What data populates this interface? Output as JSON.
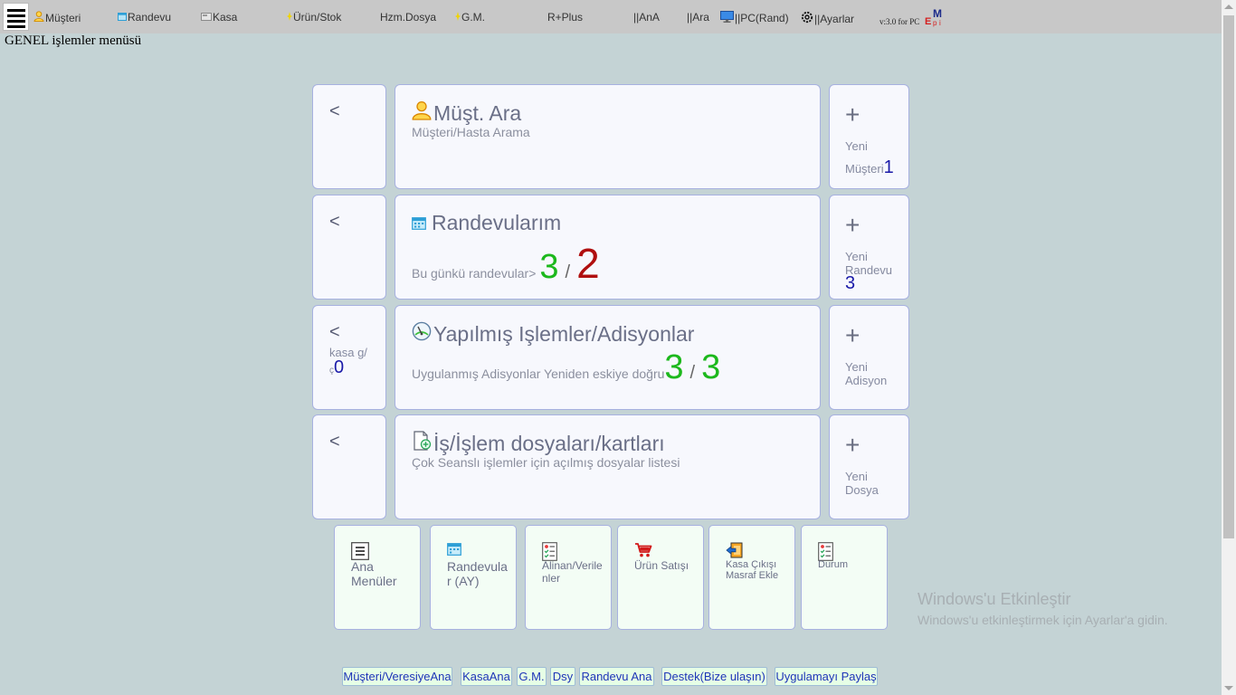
{
  "topbar": {
    "menu_icon": "hamburger-menu-icon",
    "items": [
      {
        "label": "Müşteri",
        "icon": "user-icon"
      },
      {
        "label": "Randevu",
        "icon": "calendar-icon"
      },
      {
        "label": "Kasa",
        "icon": "cash-register-icon"
      },
      {
        "label": "Ürün/Stok",
        "icon": "sparkle-icon"
      },
      {
        "label": "Hzm.Dosya"
      },
      {
        "label": "G.M.",
        "icon": "sparkle-icon"
      },
      {
        "label": "R+Plus"
      },
      {
        "label": "||AnA"
      },
      {
        "label": "||Ara"
      },
      {
        "label": "||PC(Rand)",
        "icon": "monitor-icon"
      },
      {
        "label": "||Ayarlar",
        "icon": "gear-icon"
      }
    ],
    "version": "v:3.0 for PC",
    "logo": {
      "m": "M",
      "e": "E",
      "p": "p",
      "i": "i"
    }
  },
  "page_heading": "GENEL işlemler menüsü",
  "rows": [
    {
      "back": {
        "label": "<"
      },
      "main": {
        "title": "Müşt. Ara",
        "icon": "user-icon",
        "subtitle": "Müşteri/Hasta Arama"
      },
      "add": {
        "plus": "+",
        "label_line1": "Yeni",
        "label_line2": "Müşteri",
        "count": "1"
      }
    },
    {
      "back": {
        "label": "<"
      },
      "main": {
        "title": "Randevularım",
        "icon": "calendar-icon",
        "count_label": "Bu günkü randevular>",
        "count_a": "3",
        "separator": "/",
        "count_b": "2"
      },
      "add": {
        "plus": "+",
        "label_line1": "Yeni",
        "label_line2": "Randevu",
        "count": "3"
      }
    },
    {
      "back": {
        "label": "<",
        "extra_line1": "kasa g/",
        "extra_small": "ç",
        "extra_count": "0"
      },
      "main": {
        "title": "Yapılmış Işlemler/Adisyonlar",
        "icon": "gauge-icon",
        "count_label": "Uygulanmış Adisyonlar Yeniden eskiye doğru",
        "count_a": "3",
        "separator": "/",
        "count_b": "3"
      },
      "add": {
        "plus": "+",
        "label_line1": "Yeni",
        "label_line2": "Adisyon"
      }
    },
    {
      "back": {
        "label": "<"
      },
      "main": {
        "title": "İş/İşlem dosyaları/kartları",
        "icon": "document-add-icon",
        "subtitle": "Çok Seanslı işlemler için açılmış dosyalar listesi"
      },
      "add": {
        "plus": "+",
        "label_line1": "Yeni",
        "label_line2": "Dosya"
      }
    }
  ],
  "tiles": [
    {
      "label_line1": "Ana",
      "label_line2": "Menüler",
      "icon": "list-icon"
    },
    {
      "label_line1": "Randevula",
      "label_line2": "r (AY)",
      "icon": "calendar-icon"
    },
    {
      "label_line1": "Alinan/Verile",
      "label_line2": "nler",
      "icon": "checklist-icon"
    },
    {
      "label_line1": "Ürün Satışı",
      "label_line2": "",
      "icon": "shopping-cart-icon"
    },
    {
      "label_line1": "Kasa Çıkışı",
      "label_line2": "Masraf Ekle",
      "icon": "exit-door-icon"
    },
    {
      "label_line1": "Durum",
      "label_line2": "",
      "icon": "checklist-icon"
    }
  ],
  "watermark": {
    "line1": "Windows'u Etkinleştir",
    "line2": "Windows'u etkinleştirmek için Ayarlar'a gidin."
  },
  "footer_links": [
    "Müşteri/VeresiyeAna",
    "KasaAna",
    "G.M.",
    "Dsy",
    "Randevu Ana",
    "Destek(Bize ulaşın)",
    "Uygulamayı Paylaş"
  ],
  "colors": {
    "background": "#c4d3d5",
    "card_bg": "#f7f8fd",
    "card_border": "#a7b1e0",
    "count_green": "#1cb81c",
    "count_red": "#b00f0f",
    "count_blue": "#1a1aa8",
    "tile_bg": "#f3fdf5",
    "footer_bg": "#e6ffe6"
  }
}
